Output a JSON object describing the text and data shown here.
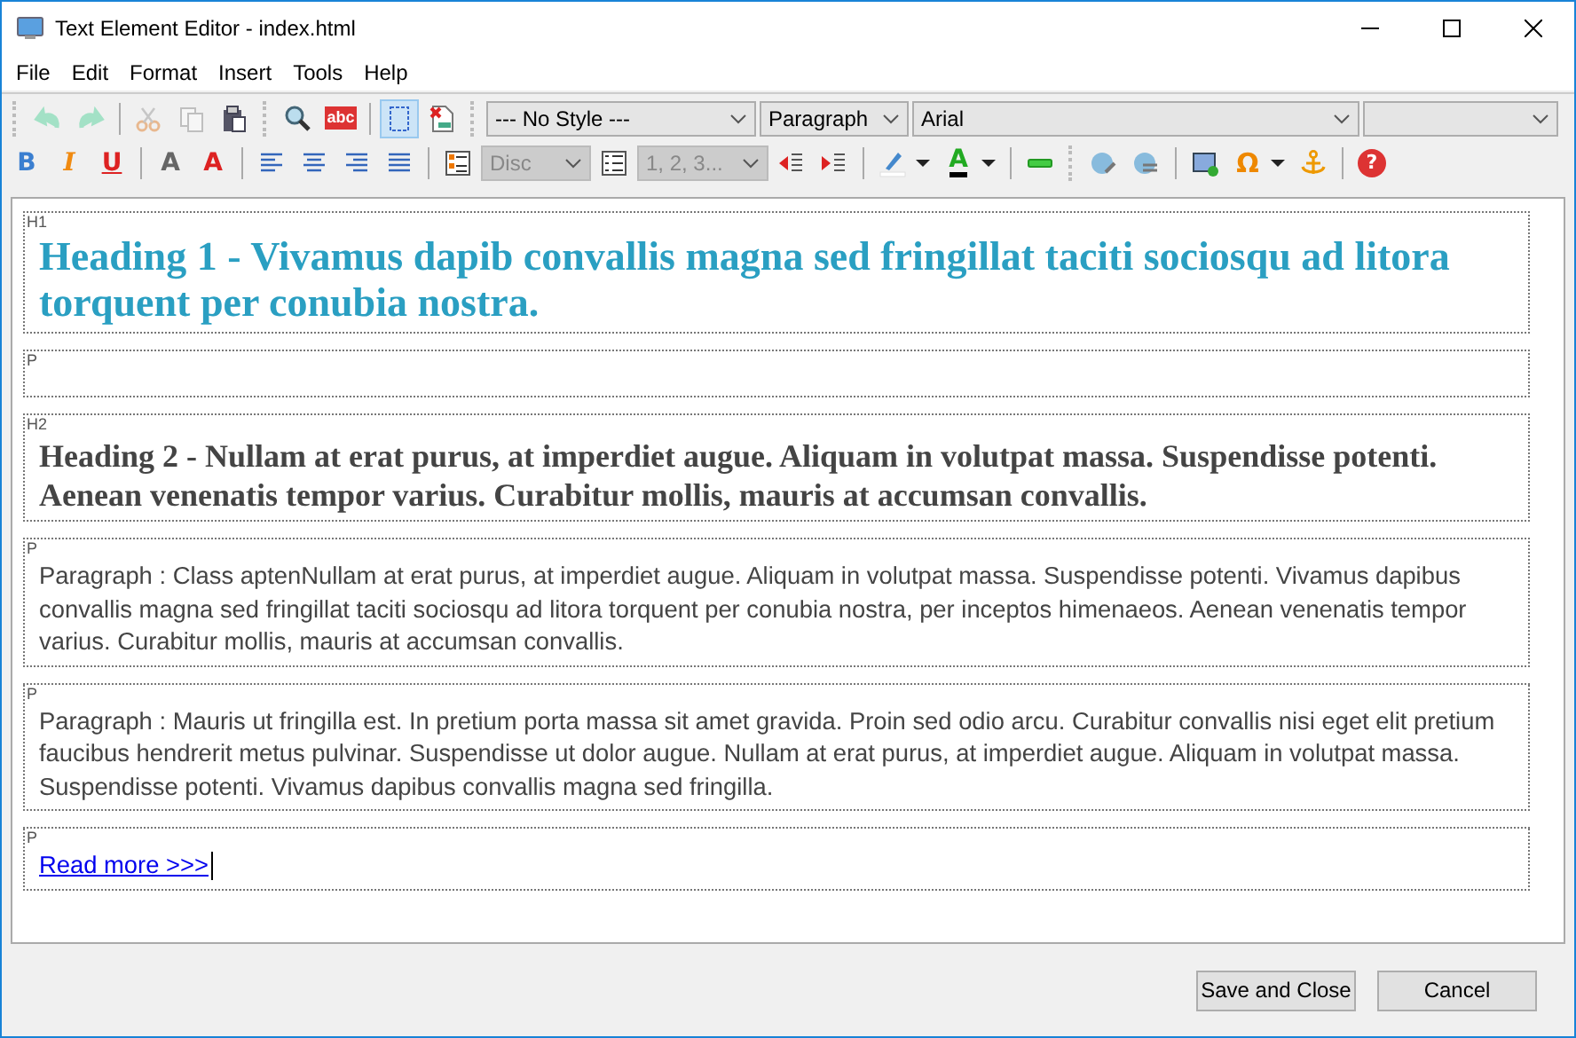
{
  "window": {
    "title": "Text Element Editor - index.html"
  },
  "menu": [
    {
      "label": "File"
    },
    {
      "label": "Edit"
    },
    {
      "label": "Format"
    },
    {
      "label": "Insert"
    },
    {
      "label": "Tools"
    },
    {
      "label": "Help"
    }
  ],
  "toolbar": {
    "rows": [
      [
        {
          "kind": "grip"
        },
        {
          "kind": "undo",
          "disabled": true
        },
        {
          "kind": "redo",
          "disabled": true
        },
        {
          "kind": "sep"
        },
        {
          "kind": "cut",
          "disabled": true
        },
        {
          "kind": "copy",
          "disabled": true
        },
        {
          "kind": "paste",
          "disabled": false
        },
        {
          "kind": "grip"
        },
        {
          "kind": "find",
          "disabled": false
        },
        {
          "kind": "spell",
          "disabled": false,
          "glyph": "abc"
        },
        {
          "kind": "sep"
        },
        {
          "kind": "blocks",
          "disabled": false,
          "selected": true
        },
        {
          "kind": "css",
          "disabled": false
        },
        {
          "kind": "grip"
        },
        {
          "kind": "style-select",
          "value": "--- No Style ---",
          "disabled": false
        },
        {
          "kind": "block-select",
          "value": "Paragraph",
          "disabled": false
        },
        {
          "kind": "font-select",
          "value": "Arial",
          "disabled": false
        },
        {
          "kind": "size-select",
          "disabled": false
        }
      ],
      [
        {
          "kind": "bold",
          "disabled": false,
          "glyph": "B"
        },
        {
          "kind": "italic",
          "disabled": false,
          "glyph": "I"
        },
        {
          "kind": "underline",
          "disabled": false,
          "glyph": "U"
        },
        {
          "kind": "sep"
        },
        {
          "kind": "subscript",
          "disabled": false,
          "glyph": "A"
        },
        {
          "kind": "superscript",
          "disabled": false,
          "glyph": "A"
        },
        {
          "kind": "sep"
        },
        {
          "kind": "align-left",
          "disabled": false
        },
        {
          "kind": "align-center",
          "disabled": false
        },
        {
          "kind": "align-right",
          "disabled": false
        },
        {
          "kind": "justify",
          "disabled": false
        },
        {
          "kind": "sep"
        },
        {
          "kind": "bullets",
          "disabled": false
        },
        {
          "kind": "bullet-select",
          "value": "Disc",
          "disabled": true
        },
        {
          "kind": "numbers",
          "disabled": false
        },
        {
          "kind": "number-select",
          "value": "1, 2, 3...",
          "disabled": true
        },
        {
          "kind": "outdent",
          "disabled": false
        },
        {
          "kind": "indent",
          "disabled": false
        },
        {
          "kind": "sep"
        },
        {
          "kind": "highlight",
          "disabled": false
        },
        {
          "kind": "textcolor",
          "disabled": false,
          "glyph": "A"
        },
        {
          "kind": "sep"
        },
        {
          "kind": "hr",
          "disabled": false
        },
        {
          "kind": "grip"
        },
        {
          "kind": "link",
          "disabled": false
        },
        {
          "kind": "unlink",
          "disabled": false
        },
        {
          "kind": "sep"
        },
        {
          "kind": "image",
          "disabled": false
        },
        {
          "kind": "symbol",
          "disabled": false,
          "glyph": "Ω"
        },
        {
          "kind": "anchor",
          "disabled": false
        },
        {
          "kind": "sep"
        },
        {
          "kind": "help",
          "disabled": false,
          "glyph": "?"
        }
      ]
    ]
  },
  "blocks": [
    {
      "tag": "H1",
      "kind": "h1",
      "text": "Heading 1 - Vivamus dapib convallis magna sed fringillat taciti sociosqu ad litora torquent per conubia nostra."
    },
    {
      "tag": "P",
      "kind": "empty"
    },
    {
      "tag": "H2",
      "kind": "h2",
      "text": "Heading 2 - Nullam at erat purus, at imperdiet augue. Aliquam in volutpat massa. Suspendisse potenti. Aenean venenatis tempor varius. Curabitur mollis, mauris at accumsan convallis."
    },
    {
      "tag": "P",
      "kind": "p",
      "text": "Paragraph : Class aptenNullam at erat purus, at imperdiet augue. Aliquam in volutpat massa. Suspendisse potenti. Vivamus dapibus convallis magna sed fringillat taciti sociosqu ad litora torquent per conubia nostra, per inceptos himenaeos. Aenean venenatis tempor varius. Curabitur mollis, mauris at accumsan convallis."
    },
    {
      "tag": "P",
      "kind": "p",
      "text": "Paragraph : Mauris ut fringilla est. In pretium porta massa sit amet gravida. Proin sed odio arcu. Curabitur convallis nisi eget elit pretium faucibus hendrerit metus pulvinar. Suspendisse ut dolor augue. Nullam at erat purus, at imperdiet augue. Aliquam in volutpat massa. Suspendisse potenti. Vivamus dapibus convallis magna sed fringilla."
    },
    {
      "tag": "P",
      "kind": "link",
      "text": "Read more >>>",
      "cursor": true
    }
  ],
  "buttons": [
    {
      "label": "Save and Close"
    },
    {
      "label": "Cancel"
    }
  ]
}
